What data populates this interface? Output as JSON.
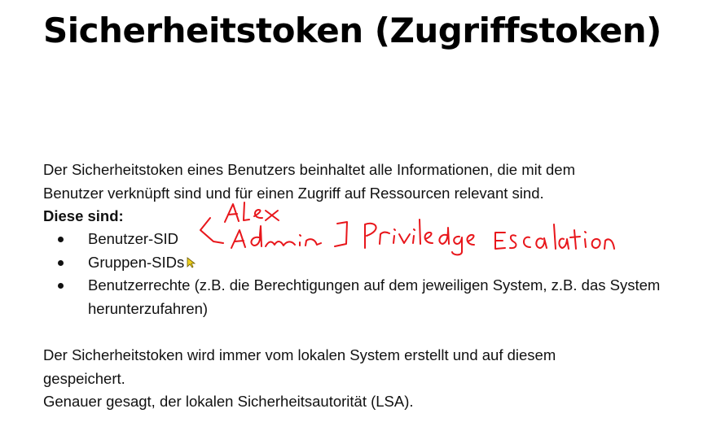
{
  "slide": {
    "title": "Sicherheitstoken (Zugriffstoken)",
    "intro_line1": "Der Sicherheitstoken eines Benutzers beinhaltet alle Informationen, die mit dem",
    "intro_line2": "Benutzer verknüpft sind und für einen Zugriff auf Ressourcen relevant sind.",
    "subheading": "Diese sind:",
    "bullets": [
      "Benutzer-SID",
      "Gruppen-SIDs",
      "Benutzerrechte (z.B. die Berechtigungen auf dem jeweiligen System, z.B. das System herunterzufahren)"
    ],
    "outro_line1": "Der Sicherheitstoken wird immer vom lokalen System erstellt und auf diesem",
    "outro_line2": "gespeichert.",
    "outro_line3": "Genauer gesagt, der lokalen Sicherheitsautorität (LSA)."
  },
  "annotation": {
    "color": "#e8161b",
    "handwriting_words": [
      "Alex",
      "Admin",
      "Priviledge Escalation"
    ]
  }
}
